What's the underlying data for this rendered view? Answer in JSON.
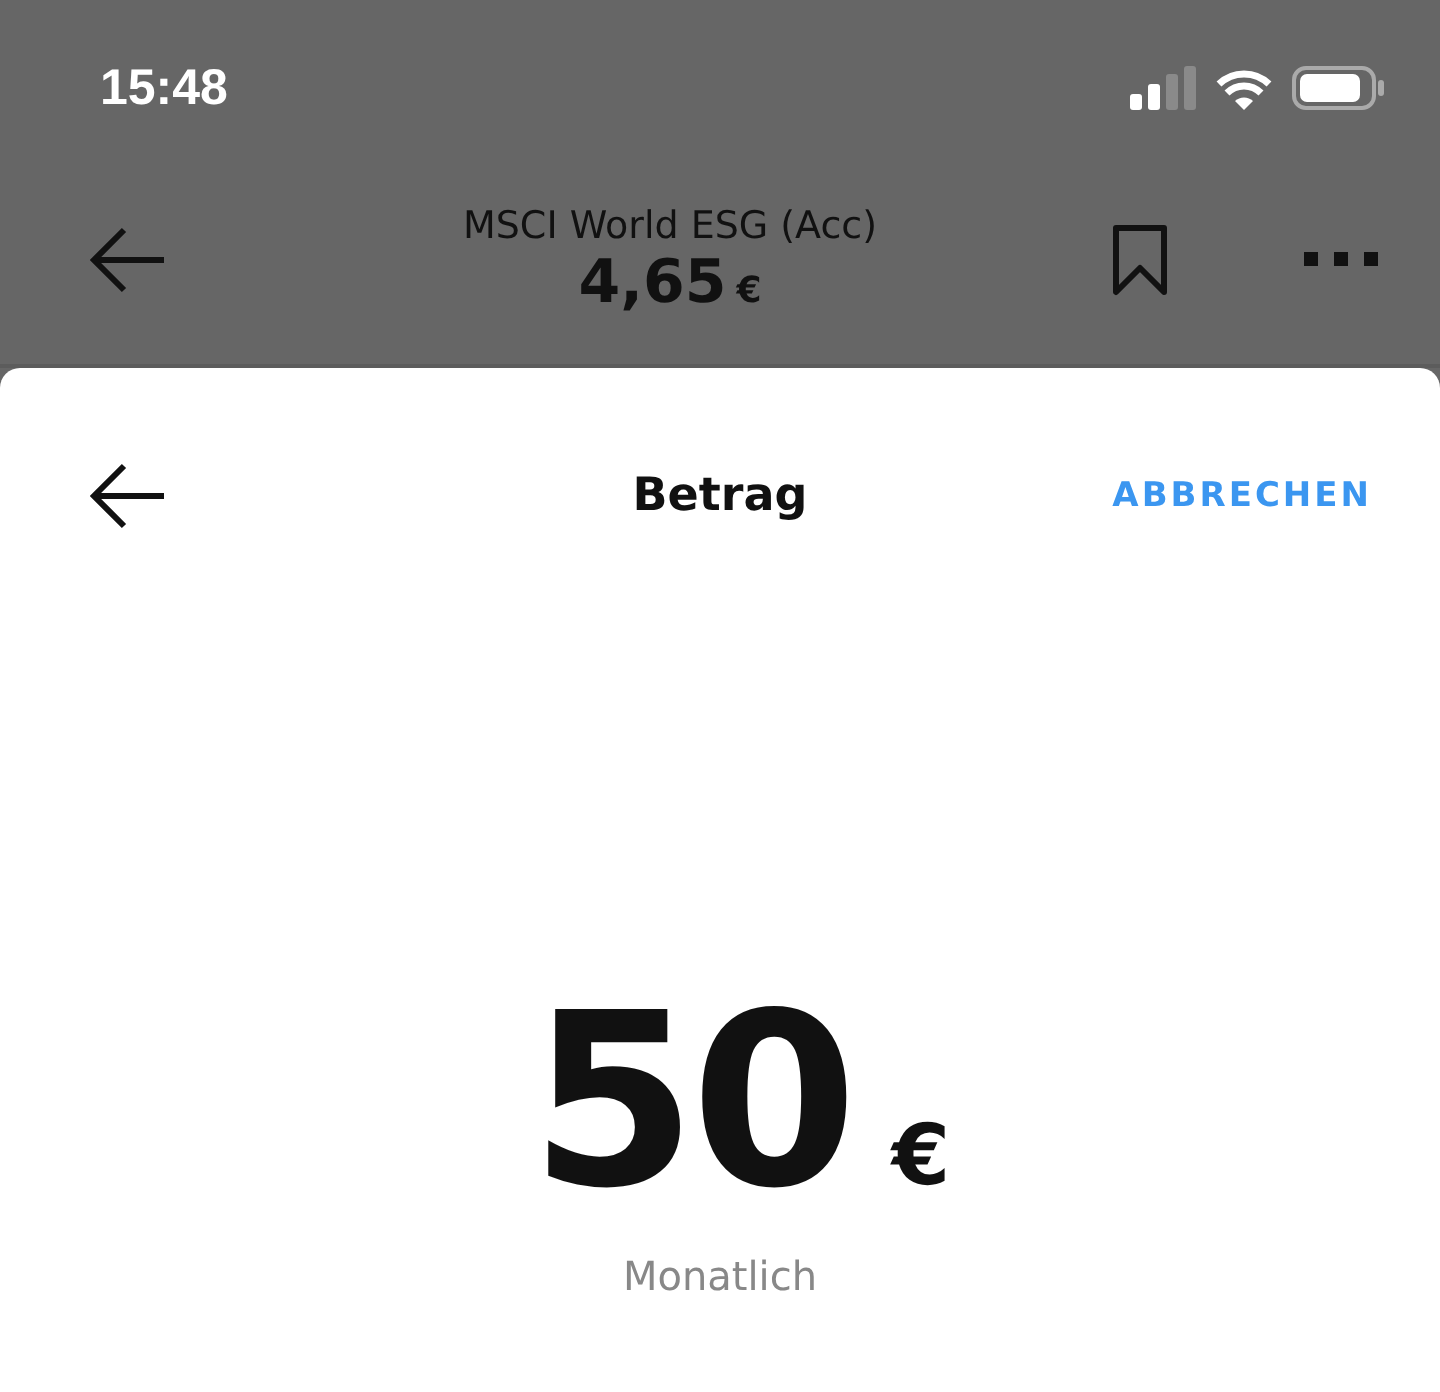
{
  "status_bar": {
    "time": "15:48"
  },
  "header": {
    "title": "MSCI World ESG (Acc)",
    "price": "4,65",
    "currency": "€"
  },
  "sheet": {
    "title": "Betrag",
    "cancel": "ABBRECHEN"
  },
  "amount": {
    "value": "50",
    "currency": "€",
    "frequency": "Monatlich"
  }
}
